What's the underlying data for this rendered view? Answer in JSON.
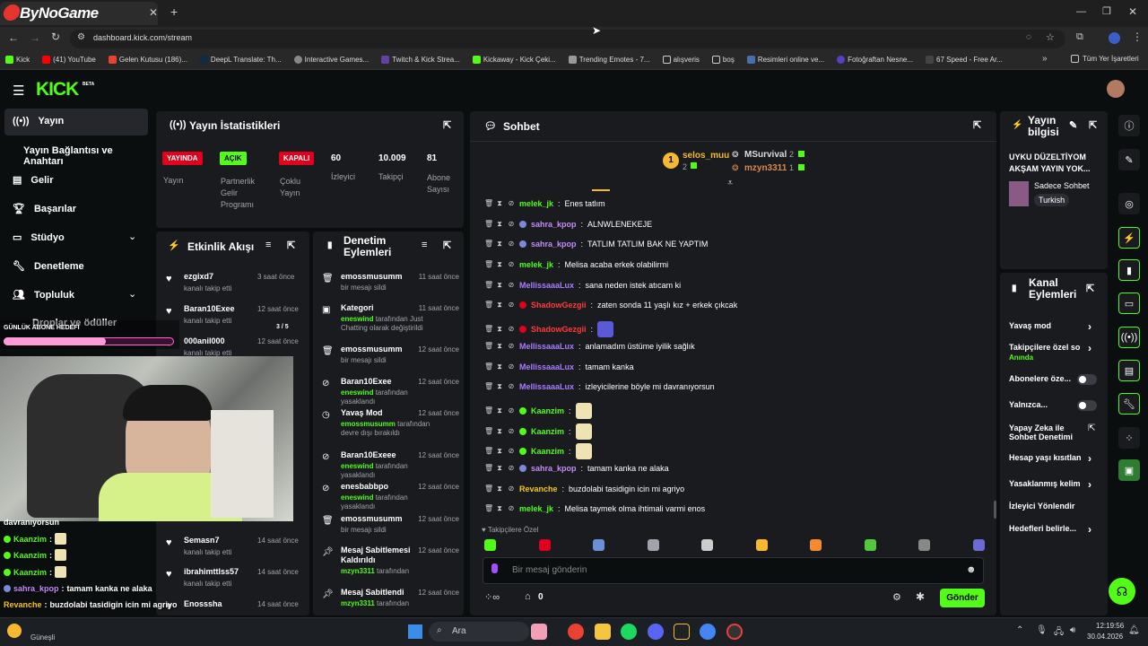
{
  "browser": {
    "logo": "ByNoGame",
    "url": "dashboard.kick.com/stream",
    "bookmarks": [
      "Kick",
      "(41) YouTube",
      "Gelen Kutusu (186)...",
      "DeepL Translate: Th...",
      "Interactive Games...",
      "Twitch & Kick Strea...",
      "Kickaway - Kick Çeki...",
      "Trending Emotes - 7...",
      "alışveris",
      "boş",
      "Resimleri online ve...",
      "Fotoğraftan Nesne...",
      "67 Speed - Free Ar..."
    ],
    "bookmarks_more": "»",
    "all_bookmarks": "Tüm Yer İşaretleri"
  },
  "kick": {
    "logo": "KICK",
    "beta": "BETA"
  },
  "sidebar": {
    "items": [
      {
        "label": "Yayın",
        "icon": "broadcast-icon"
      },
      {
        "label": "Yayın Bağlantısı ve Anahtarı",
        "icon": ""
      },
      {
        "label": "Gelir",
        "icon": "chart-icon"
      },
      {
        "label": "Başarılar",
        "icon": "trophy-icon"
      },
      {
        "label": "Stüdyo",
        "icon": "studio-icon"
      },
      {
        "label": "Denetleme",
        "icon": "wrench-icon"
      },
      {
        "label": "Topluluk",
        "icon": "people-icon"
      },
      {
        "label": "Droplar ve ödüller",
        "icon": "gift-icon"
      }
    ]
  },
  "stats": {
    "title": "Yayın İstatistikleri",
    "items": [
      {
        "badge": "YAYINDA",
        "label": "Yayın"
      },
      {
        "badge": "AÇIK",
        "label": "Partnerlik Gelir Programı"
      },
      {
        "badge": "KAPALI",
        "label": "Çoklu Yayın"
      },
      {
        "value": "60",
        "label": "İzleyici"
      },
      {
        "value": "10.009",
        "label": "Takipçi"
      },
      {
        "value": "81",
        "label": "Abone Sayısı"
      }
    ]
  },
  "activity": {
    "title": "Etkinlik Akışı",
    "items": [
      {
        "name": "ezgixd7",
        "desc": "kanalı takip etti",
        "time": "3 saat önce"
      },
      {
        "name": "Baran10Exee",
        "desc": "kanalı takip etti",
        "time": "12 saat önce"
      },
      {
        "name": "000anil000",
        "desc": "kanalı takip etti",
        "time": "12 saat önce"
      },
      {
        "name": "Semasn7",
        "desc": "kanalı takip etti",
        "time": "14 saat önce"
      },
      {
        "name": "ibrahimttlss57",
        "desc": "kanalı takip etti",
        "time": "14 saat önce"
      },
      {
        "name": "Enosssha",
        "desc": "",
        "time": "14 saat önce"
      }
    ]
  },
  "moderation": {
    "title": "Denetim Eylemleri",
    "items": [
      {
        "title": "emossmusumm",
        "desc": "bir mesajı sildi",
        "time": "11 saat önce"
      },
      {
        "title": "Kategori",
        "user": "eneswind",
        "desc": "tarafından Just Chatting olarak değiştirildi",
        "time": "11 saat önce"
      },
      {
        "title": "emossmusumm",
        "desc": "bir mesajı sildi",
        "time": "12 saat önce"
      },
      {
        "title": "Baran10Exee",
        "user": "eneswind",
        "desc": "tarafından yasaklandı",
        "time": "12 saat önce"
      },
      {
        "title": "Yavaş Mod",
        "user": "emossmusumm",
        "desc": "tarafından devre dışı bırakıldı",
        "time": "12 saat önce"
      },
      {
        "title": "Baran10Exeee",
        "user": "eneswind",
        "desc": "tarafından yasaklandı",
        "time": "12 saat önce"
      },
      {
        "title": "enesbabbpo",
        "user": "eneswind",
        "desc": "tarafından yasaklandı",
        "time": "12 saat önce"
      },
      {
        "title": "emossmusumm",
        "desc": "bir mesajı sildi",
        "time": "12 saat önce"
      },
      {
        "title": "Mesaj Sabitlemesi Kaldırıldı",
        "user": "mzyn3311",
        "desc": "tarafından",
        "time": "12 saat önce"
      },
      {
        "title": "Mesaj Sabitlendi",
        "user": "mzyn3311",
        "desc": "tarafından",
        "time": "12 saat önce"
      }
    ]
  },
  "chat": {
    "title": "Sohbet",
    "leaderboard": [
      {
        "rank": "1",
        "name": "selos_muu",
        "count": "2"
      },
      {
        "name": "MSurvival",
        "count": "2"
      },
      {
        "name": "mzyn3311",
        "count": "1"
      }
    ],
    "messages": [
      {
        "user": "melek_jk",
        "color": "#53fc18",
        "text": "Enes tatlım"
      },
      {
        "user": "sahra_kpop",
        "color": "#c58af9",
        "text": "ALNWLENEKEJE"
      },
      {
        "user": "sahra_kpop",
        "color": "#c58af9",
        "text": "TATLIM TATLIM BAK NE YAPTIM"
      },
      {
        "user": "melek_jk",
        "color": "#53fc18",
        "text": "Melisa acaba erkek olabilirmi"
      },
      {
        "user": "MellissaaaLux",
        "color": "#a97cff",
        "text": "sana neden istek atıcam ki"
      },
      {
        "user": "ShadowGezgii",
        "color": "#ff3b3b",
        "text": "zaten sonda 11 yaşlı kız + erkek çıkcak"
      },
      {
        "user": "ShadowGezgii",
        "color": "#ff3b3b",
        "text": ""
      },
      {
        "user": "MellissaaaLux",
        "color": "#a97cff",
        "text": "anlamadım üstüme iyilik sağlık"
      },
      {
        "user": "MellissaaaLux",
        "color": "#a97cff",
        "text": "tamam kanka"
      },
      {
        "user": "MellissaaaLux",
        "color": "#a97cff",
        "text": "izleyicilerine böyle mi davranıyorsun"
      },
      {
        "user": "Kaanzim",
        "color": "#53fc18",
        "text": ""
      },
      {
        "user": "Kaanzim",
        "color": "#53fc18",
        "text": ""
      },
      {
        "user": "Kaanzim",
        "color": "#53fc18",
        "text": ""
      },
      {
        "user": "sahra_kpop",
        "color": "#c58af9",
        "text": "tamam kanka ne alaka"
      },
      {
        "user": "Revanche",
        "color": "#f5c518",
        "text": "buzdolabi tasidigin icin mi agriyo"
      },
      {
        "user": "melek_jk",
        "color": "#53fc18",
        "text": "Melisa taymek olma ihtimali varmi enos"
      }
    ],
    "followers_only": "Takipçilere Özel",
    "input_placeholder": "Bir mesaj gönderin",
    "points": "0",
    "send": "Gönder"
  },
  "stream_info": {
    "title": "Yayın bilgisi",
    "stream_title": "UYKU DÜZELTİYOM AKŞAM YAYIN YOK...",
    "category": "Sadece Sohbet",
    "language": "Turkish"
  },
  "channel_actions": {
    "title": "Kanal Eylemleri",
    "items": [
      {
        "label": "Yavaş mod",
        "sub": "",
        "type": "arrow"
      },
      {
        "label": "Takipçilere özel so",
        "sub": "Anında",
        "type": "arrow"
      },
      {
        "label": "Abonelere öze...",
        "sub": "",
        "type": "toggle"
      },
      {
        "label": "Yalnızca...",
        "sub": "",
        "type": "toggle"
      },
      {
        "label": "Yapay Zeka ile Sohbet Denetimi",
        "sub": "",
        "type": "ext"
      },
      {
        "label": "Hesap yaşı kısıtlan",
        "sub": "",
        "type": "arrow"
      },
      {
        "label": "Yasaklanmış kelim",
        "sub": "",
        "type": "arrow"
      },
      {
        "label": "İzleyici Yönlendir",
        "sub": "",
        "type": "none"
      },
      {
        "label": "Hedefleri belirle...",
        "sub": "",
        "type": "arrow"
      }
    ]
  },
  "overlay": {
    "goal_label": "GÜNLÜK ABONE HEDEFİ",
    "goal_count": "3 / 5",
    "goal_progress": 0.6,
    "partial_line": "davranıyorsun",
    "chat": [
      {
        "user": "Kaanzim",
        "color": "#53fc18",
        "text": ""
      },
      {
        "user": "Kaanzim",
        "color": "#53fc18",
        "text": ""
      },
      {
        "user": "Kaanzim",
        "color": "#53fc18",
        "text": ""
      },
      {
        "user": "sahra_kpop",
        "color": "#c58af9",
        "text": "tamam kanka ne alaka"
      },
      {
        "user": "Revanche",
        "color": "#f5c518",
        "text": "buzdolabi tasidigin icin mi agriyo"
      },
      {
        "user": "melek_jk",
        "color": "#53fc18",
        "text": "Melisa taymek olma ihtimali varmi enos"
      }
    ]
  },
  "taskbar": {
    "weather": "Güneşli",
    "search": "Ara",
    "time": "12:19:56",
    "date": "30.04.2026"
  }
}
